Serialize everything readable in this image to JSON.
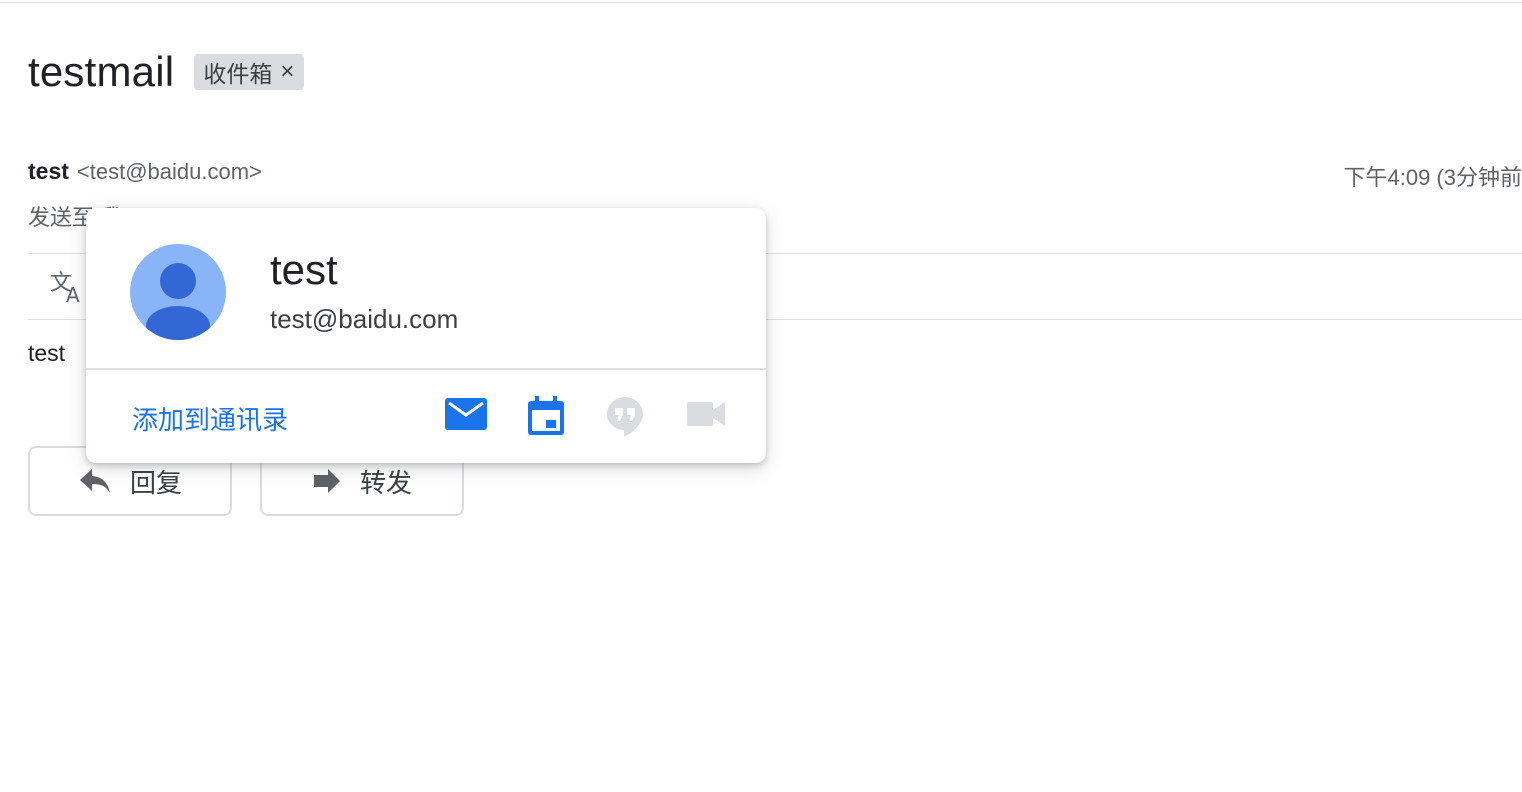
{
  "email": {
    "subject": "testmail",
    "label_chip": "收件箱",
    "label_remove": "×",
    "sender_name": "test",
    "sender_email": "<test@baidu.com>",
    "timestamp": "下午4:09 (3分钟前",
    "recipient_line": "发送至 我",
    "body": "test"
  },
  "actions": {
    "reply_label": "回复",
    "forward_label": "转发"
  },
  "contact_card": {
    "name": "test",
    "email": "test@baidu.com",
    "add_to_contacts": "添加到通讯录",
    "icons": [
      "email-icon",
      "calendar-icon",
      "hangouts-icon",
      "video-call-icon"
    ]
  },
  "colors": {
    "accent_blue": "#1a73e8",
    "avatar_bg": "#8ab4f8",
    "avatar_fg": "#3367d6",
    "disabled_icon": "#dadce0"
  }
}
